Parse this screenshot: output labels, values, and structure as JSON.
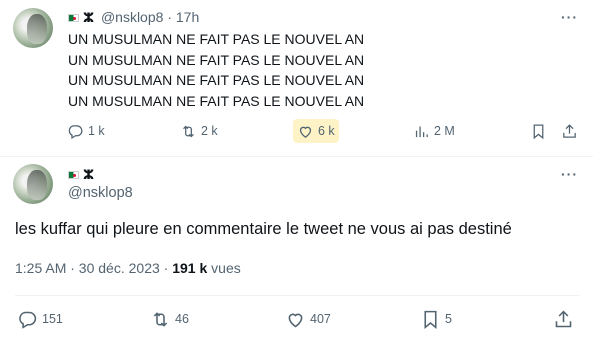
{
  "tweet1": {
    "handle": "@nsklop8",
    "separator": "·",
    "time": "17h",
    "flag_icon": "algeria-flag-icon",
    "symbol": "ⵣ",
    "text": "UN MUSULMAN NE FAIT PAS LE NOUVEL AN\nUN MUSULMAN NE FAIT PAS LE NOUVEL AN\nUN MUSULMAN NE FAIT PAS LE NOUVEL AN\nUN MUSULMAN NE FAIT PAS LE NOUVEL AN",
    "more": "···",
    "actions": {
      "replies": "1 k",
      "retweets": "2 k",
      "likes": "6 k",
      "views": "2 M"
    }
  },
  "tweet2": {
    "flag_icon": "algeria-flag-icon",
    "symbol": "ⵣ",
    "handle": "@nsklop8",
    "more": "···",
    "text": "les kuffar qui pleure en commentaire le tweet ne vous ai pas destiné",
    "timestamp": "1:25 AM · 30 déc. 2023 · ",
    "views_count": "191 k",
    "views_label": " vues",
    "actions": {
      "replies": "151",
      "retweets": "46",
      "likes": "407",
      "bookmarks": "5"
    }
  },
  "colors": {
    "text": "#0f1419",
    "muted": "#536471",
    "highlight": "#fdf3c6",
    "divider": "#eff3f4"
  }
}
